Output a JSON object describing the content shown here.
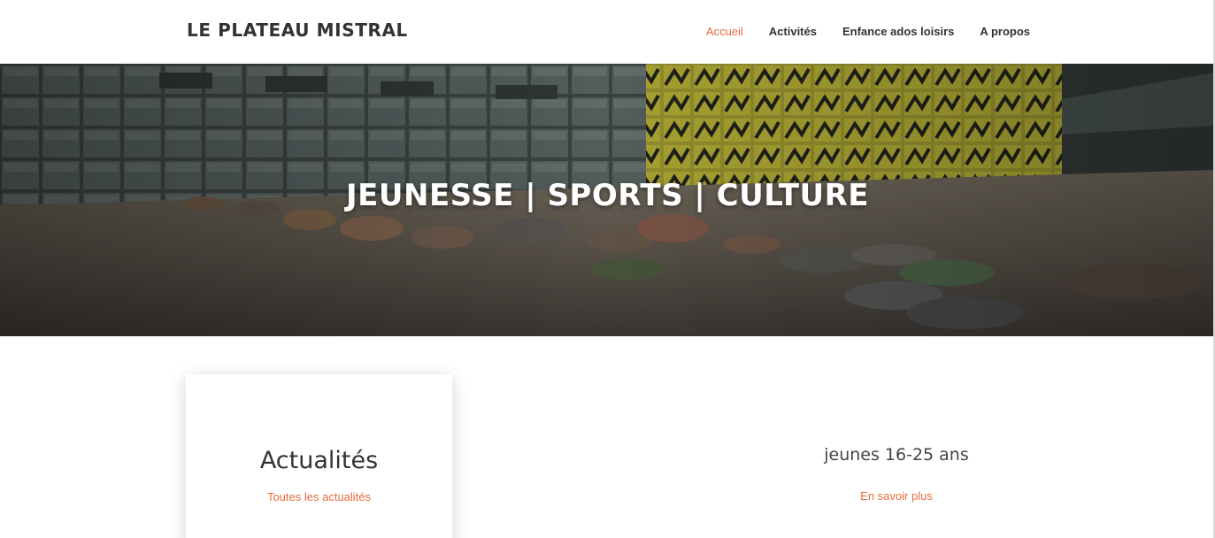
{
  "site": {
    "logo": "LE PLATEAU MISTRAL"
  },
  "nav": {
    "items": [
      {
        "label": "Accueil",
        "active": true
      },
      {
        "label": "Activités",
        "active": false
      },
      {
        "label": "Enfance ados loisirs",
        "active": false
      },
      {
        "label": "A propos",
        "active": false
      }
    ]
  },
  "hero": {
    "title": "JEUNESSE | SPORTS | CULTURE"
  },
  "news_card": {
    "title": "Actualités",
    "link": "Toutes les actualités"
  },
  "youth_block": {
    "title": "jeunes 16-25 ans",
    "link": "En savoir plus"
  },
  "colors": {
    "accent": "#e56a3e",
    "text": "#333333"
  }
}
